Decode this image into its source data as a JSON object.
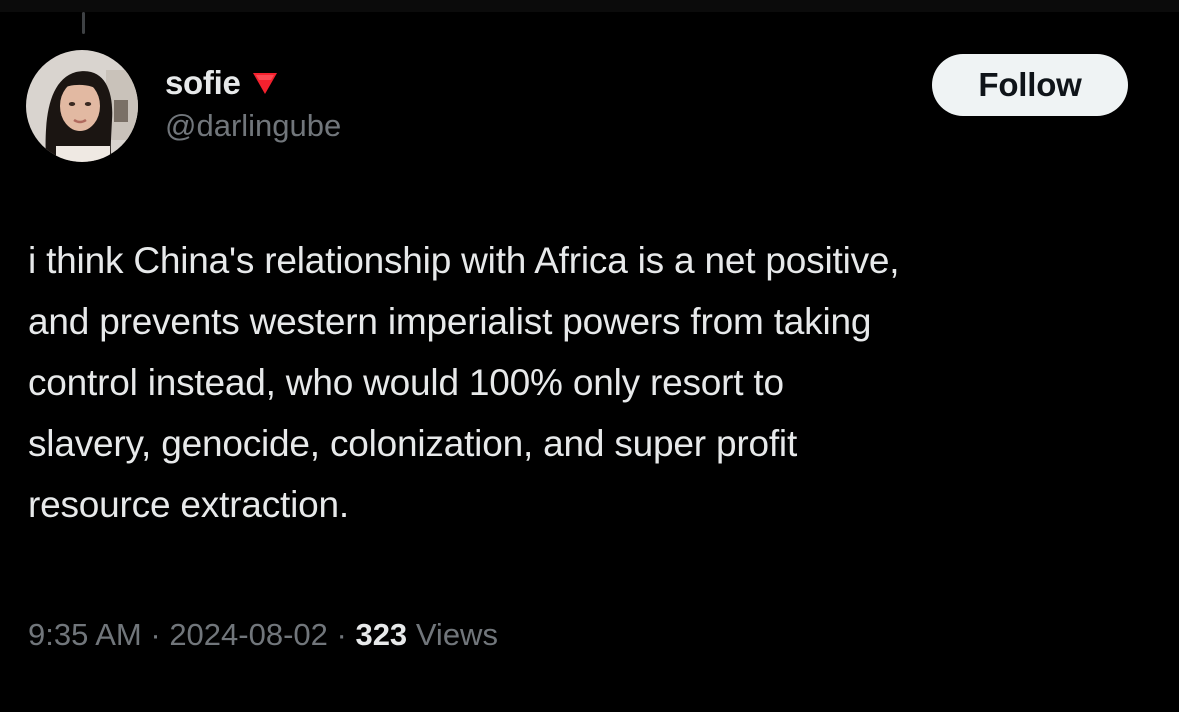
{
  "author": {
    "display_name": "sofie",
    "badge_icon": "red-triangle-down-icon",
    "badge_color": "#f4212e",
    "handle": "@darlingube",
    "avatar": "profile-photo"
  },
  "actions": {
    "follow_label": "Follow"
  },
  "tweet": {
    "lines": [
      "i think China's relationship with Africa is a net positive,",
      "and prevents western imperialist powers from taking",
      "control instead, who would 100% only resort to",
      "slavery, genocide, colonization, and super profit",
      "resource extraction."
    ]
  },
  "meta": {
    "time": "9:35 AM",
    "separator": " · ",
    "date": "2024-08-02",
    "views_count": "323",
    "views_label": "Views"
  },
  "theme": {
    "background": "#000000",
    "text_primary": "#e7e9ea",
    "text_secondary": "#71767b",
    "button_bg": "#eff3f4"
  }
}
